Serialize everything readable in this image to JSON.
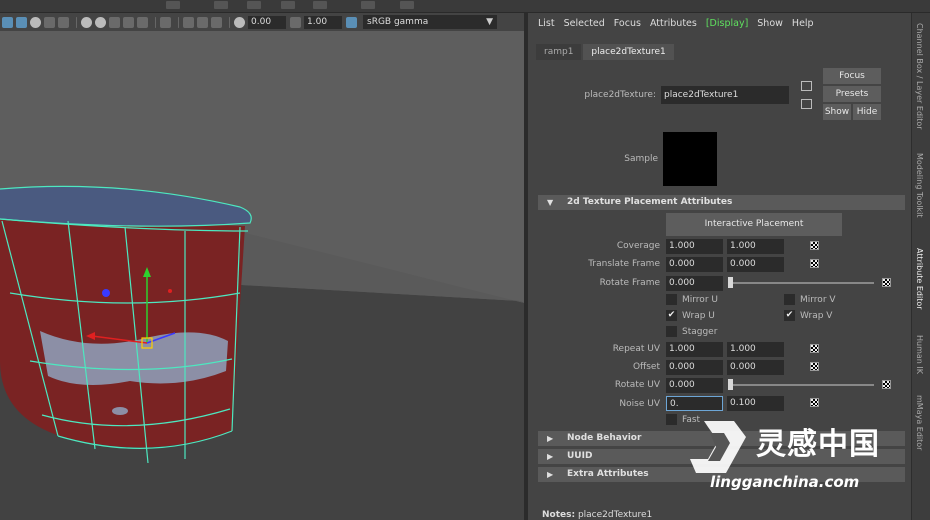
{
  "viewport_toolbar": {
    "exposure_value": "0.00",
    "gamma_value": "1.00",
    "color_space": "sRGB gamma"
  },
  "attribute_editor": {
    "menu": [
      "List",
      "Selected",
      "Focus",
      "Attributes",
      "[Display]",
      "Show",
      "Help"
    ],
    "tabs": [
      "ramp1",
      "place2dTexture1"
    ],
    "node_type_label": "place2dTexture:",
    "node_name": "place2dTexture1",
    "buttons": {
      "focus": "Focus",
      "presets": "Presets",
      "show": "Show",
      "hide": "Hide"
    },
    "sample_label": "Sample",
    "section_placement": "2d Texture Placement Attributes",
    "interactive_placement": "Interactive Placement",
    "rows": {
      "coverage": {
        "label": "Coverage",
        "v1": "1.000",
        "v2": "1.000"
      },
      "translate_frame": {
        "label": "Translate Frame",
        "v1": "0.000",
        "v2": "0.000"
      },
      "rotate_frame": {
        "label": "Rotate Frame",
        "v1": "0.000"
      },
      "repeat_uv": {
        "label": "Repeat UV",
        "v1": "1.000",
        "v2": "1.000"
      },
      "offset": {
        "label": "Offset",
        "v1": "0.000",
        "v2": "0.000"
      },
      "rotate_uv": {
        "label": "Rotate UV",
        "v1": "0.000"
      },
      "noise_uv": {
        "label": "Noise UV",
        "v1": "0.",
        "v2": "0.100"
      }
    },
    "checkboxes": {
      "mirror_u": {
        "label": "Mirror U",
        "checked": false
      },
      "mirror_v": {
        "label": "Mirror V",
        "checked": false
      },
      "wrap_u": {
        "label": "Wrap U",
        "checked": true
      },
      "wrap_v": {
        "label": "Wrap V",
        "checked": true
      },
      "stagger": {
        "label": "Stagger",
        "checked": false
      },
      "fast": {
        "label": "Fast",
        "checked": false
      }
    },
    "check_mark": "✔",
    "sections_collapsed": [
      "Node Behavior",
      "UUID",
      "Extra Attributes"
    ],
    "notes_label": "Notes:",
    "notes_value": "place2dTexture1"
  },
  "side_tabs": [
    "Channel Box / Layer Editor",
    "Modeling Toolkit",
    "Attribute Editor",
    "Human IK",
    "mMaya Editor"
  ],
  "watermark": {
    "chinese": "灵感中国",
    "url": "lingganchina.com"
  },
  "colors": {
    "display_highlight": "#5fe05f",
    "focus_border": "#6da6d6",
    "cup_body": "#7a2323",
    "cup_rim": "#4a5a80",
    "wireframe": "#4de8c0"
  }
}
